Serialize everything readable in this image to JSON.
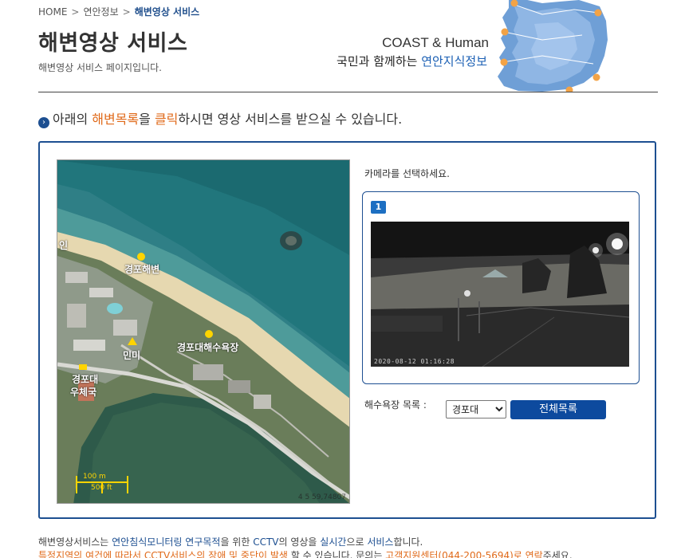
{
  "breadcrumb": {
    "home": "HOME",
    "section": "연안정보",
    "current": "해변영상 서비스",
    "separator": ">"
  },
  "header": {
    "title": "해변영상 서비스",
    "subtitle": "해변영상 서비스 페이지입니다."
  },
  "banner": {
    "en_title": "COAST & Human",
    "ko_prefix": "국민과 함께하는 ",
    "ko_highlight": "연안지식정보"
  },
  "instruction": {
    "part1": "아래의 ",
    "highlight1": "해변목록",
    "part2": "을 ",
    "highlight2": "클릭",
    "part3": "하시면 영상 서비스를 받으실 수 있습니다."
  },
  "map": {
    "labels": {
      "top_left_fragment": "인",
      "gyeongpo_beach": "경포해변",
      "gyeongpo_bathing": "경포대해수욕장",
      "minmi": "민미",
      "post_office_line1": "경포대",
      "post_office_line2": "우체국"
    },
    "scale_m": "100 m",
    "scale_ft": "500 ft",
    "coord_readout": "4 5  59,74807"
  },
  "camera": {
    "prompt": "카메라를 선택하세요.",
    "badge": "1",
    "timestamp": "2020-08-12 01:16:28"
  },
  "controls": {
    "beach_list_label": "해수욕장 목록 :",
    "selected_beach": "경포대",
    "full_list_button": "전체목록"
  },
  "notice": {
    "line1_part1": "해변영상서비스는 ",
    "line1_blue1": "연안침식모니터링 연구목적",
    "line1_part2": "을 위한 ",
    "line1_blue2": "CCTV",
    "line1_part3": "의 영상을 ",
    "line1_blue3": "실시간",
    "line1_part4": "으로 ",
    "line1_blue4": "서비스",
    "line1_part5": "합니다.",
    "line2_orange1": "특정지역의 여건에 따라서 CCTV서비스의 장애 및 중단이 발생",
    "line2_part1": " 할 수 있습니다. 문의는 ",
    "line2_orange2": "고객지원센터(044-200-5694)로 연락",
    "line2_part2": "주세요."
  },
  "colors": {
    "brand_blue": "#1d4f91",
    "accent_orange": "#e06a1a",
    "button_blue": "#0d4a9e"
  }
}
